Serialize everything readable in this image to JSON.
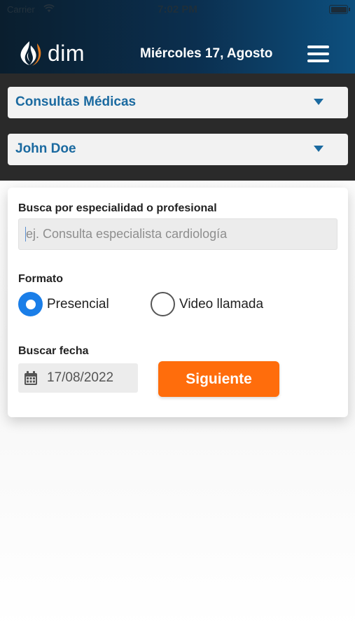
{
  "status_bar": {
    "carrier": "Carrier",
    "time": "7:02 PM",
    "wifi_icon": "wifi-icon",
    "battery_icon": "battery-icon"
  },
  "header": {
    "logo_text": "dim",
    "logo_icon": "flame-logo-icon",
    "date": "Miércoles 17, Agosto",
    "menu_icon": "hamburger-menu-icon"
  },
  "selectors": {
    "service": "Consultas Médicas",
    "patient": "John Doe",
    "caret_icon": "chevron-down-icon"
  },
  "search": {
    "label": "Busca por especialidad o profesional",
    "placeholder": "ej. Consulta especialista cardiología",
    "value": ""
  },
  "format": {
    "label": "Formato",
    "options": [
      {
        "label": "Presencial",
        "selected": true
      },
      {
        "label": "Video llamada",
        "selected": false
      }
    ]
  },
  "date_search": {
    "label": "Buscar fecha",
    "value": "17/08/2022",
    "icon": "calendar-icon"
  },
  "actions": {
    "next_label": "Siguiente"
  },
  "colors": {
    "accent_blue": "#1b6aa0",
    "radio_blue": "#1a7ee8",
    "button_orange": "#ff6d0c",
    "band_dark": "#2a2a2a"
  }
}
